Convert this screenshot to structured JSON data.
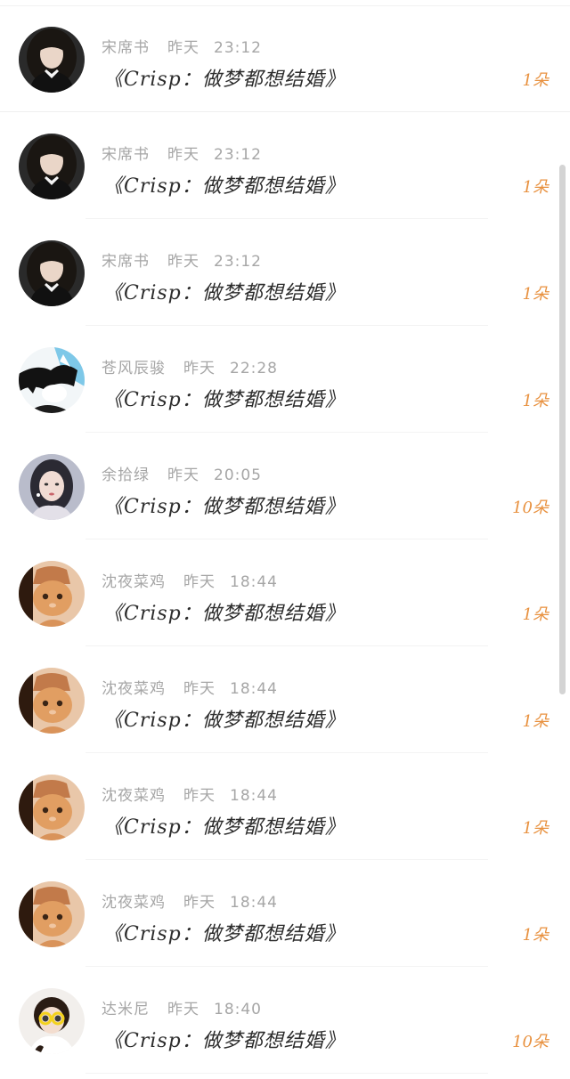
{
  "items": [
    {
      "name": "宋席书",
      "day": "昨天",
      "time": "23:12",
      "title": "《Crisp：做梦都想结婚》",
      "count": "1朵",
      "avatar": "girl-dark-hair"
    },
    {
      "name": "宋席书",
      "day": "昨天",
      "time": "23:12",
      "title": "《Crisp：做梦都想结婚》",
      "count": "1朵",
      "avatar": "girl-dark-hair"
    },
    {
      "name": "宋席书",
      "day": "昨天",
      "time": "23:12",
      "title": "《Crisp：做梦都想结婚》",
      "count": "1朵",
      "avatar": "girl-dark-hair"
    },
    {
      "name": "苍风辰骏",
      "day": "昨天",
      "time": "22:28",
      "title": "《Crisp：做梦都想结婚》",
      "count": "1朵",
      "avatar": "anime-boy"
    },
    {
      "name": "余拾绿",
      "day": "昨天",
      "time": "20:05",
      "title": "《Crisp：做梦都想结婚》",
      "count": "10朵",
      "avatar": "girl-portrait"
    },
    {
      "name": "沈夜菜鸡",
      "day": "昨天",
      "time": "18:44",
      "title": "《Crisp：做梦都想结婚》",
      "count": "1朵",
      "avatar": "orange-cat"
    },
    {
      "name": "沈夜菜鸡",
      "day": "昨天",
      "time": "18:44",
      "title": "《Crisp：做梦都想结婚》",
      "count": "1朵",
      "avatar": "orange-cat"
    },
    {
      "name": "沈夜菜鸡",
      "day": "昨天",
      "time": "18:44",
      "title": "《Crisp：做梦都想结婚》",
      "count": "1朵",
      "avatar": "orange-cat"
    },
    {
      "name": "沈夜菜鸡",
      "day": "昨天",
      "time": "18:44",
      "title": "《Crisp：做梦都想结婚》",
      "count": "1朵",
      "avatar": "orange-cat"
    },
    {
      "name": "达米尼",
      "day": "昨天",
      "time": "18:40",
      "title": "《Crisp：做梦都想结婚》",
      "count": "10朵",
      "avatar": "child-sunglasses"
    }
  ],
  "colors": {
    "count": "#e8913f",
    "meta": "#a6a6a6",
    "title": "#2c2c2c"
  }
}
